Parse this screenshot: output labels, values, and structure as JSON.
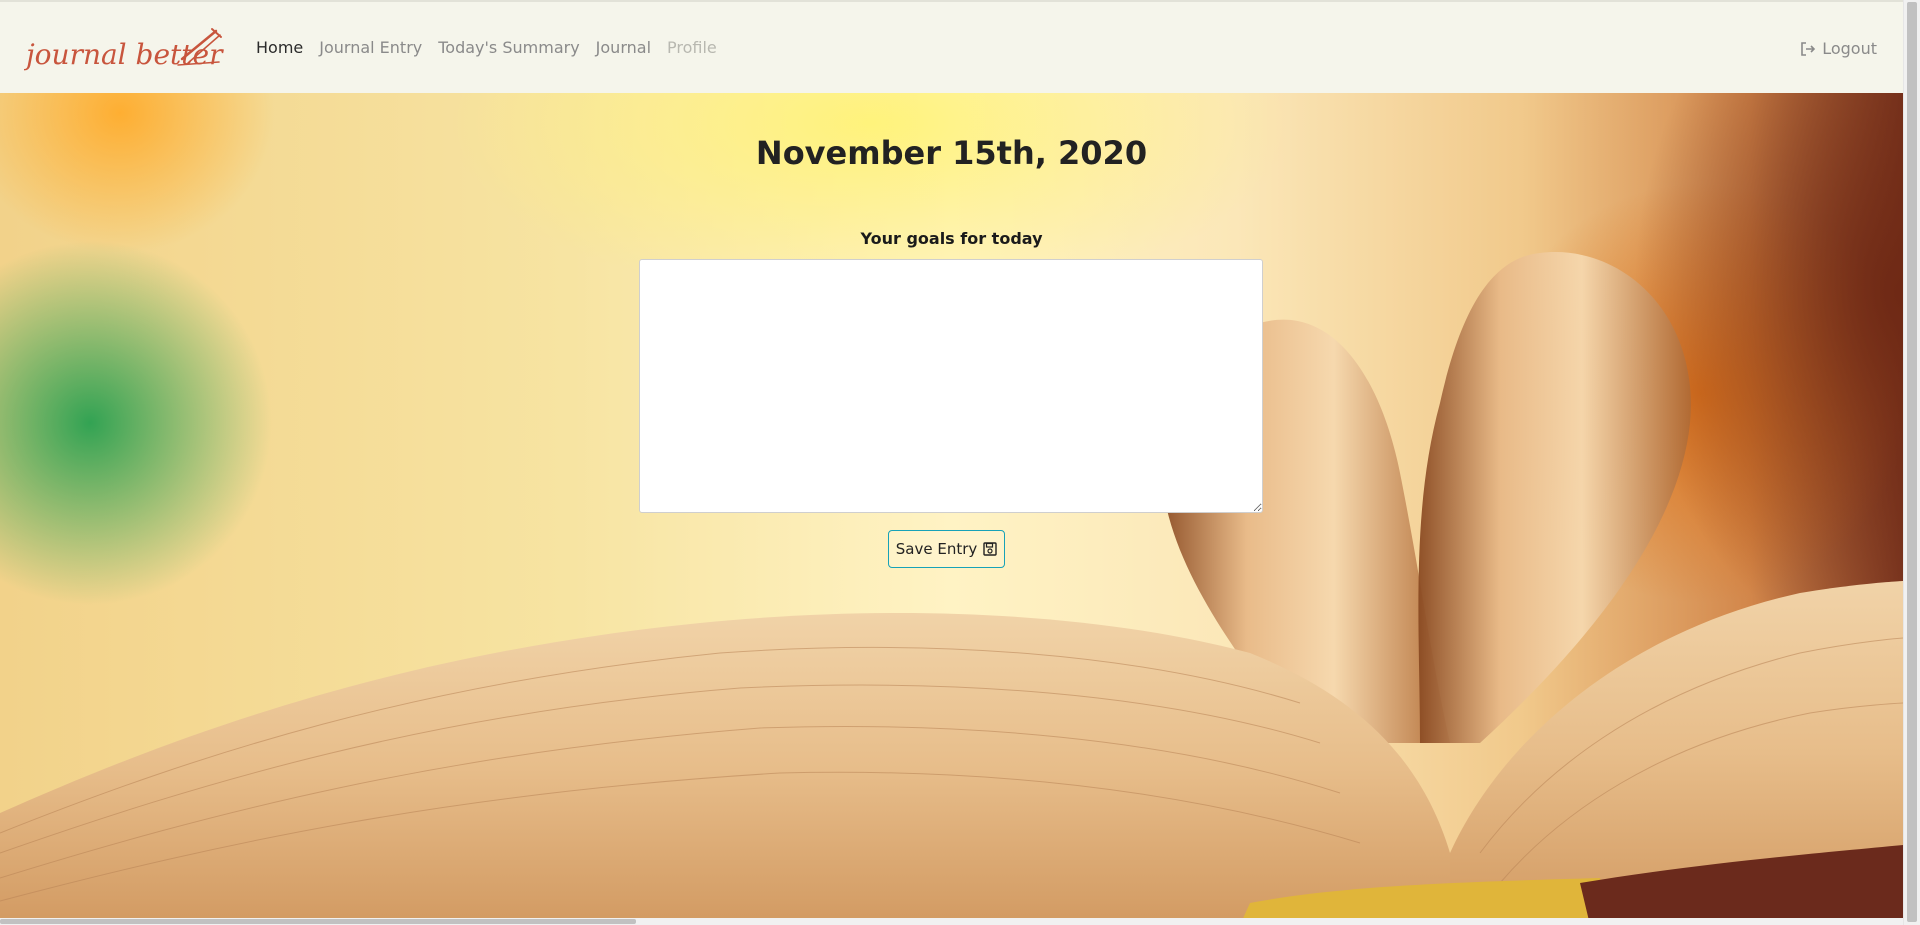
{
  "brand": {
    "name": "journal better",
    "icon": "pencil-icon",
    "color": "#c8553d"
  },
  "nav": {
    "items": [
      {
        "label": "Home",
        "state": "active"
      },
      {
        "label": "Journal Entry",
        "state": "normal"
      },
      {
        "label": "Today's Summary",
        "state": "normal"
      },
      {
        "label": "Journal",
        "state": "normal"
      },
      {
        "label": "Profile",
        "state": "disabled"
      }
    ],
    "logout_label": "Logout",
    "logout_icon": "sign-out-icon"
  },
  "main": {
    "date_title": "November 15th, 2020",
    "goals_label": "Your goals for today",
    "goals_value": "",
    "save_label": "Save Entry",
    "save_icon": "floppy-disk-icon",
    "accent_color": "#17a2b8"
  }
}
